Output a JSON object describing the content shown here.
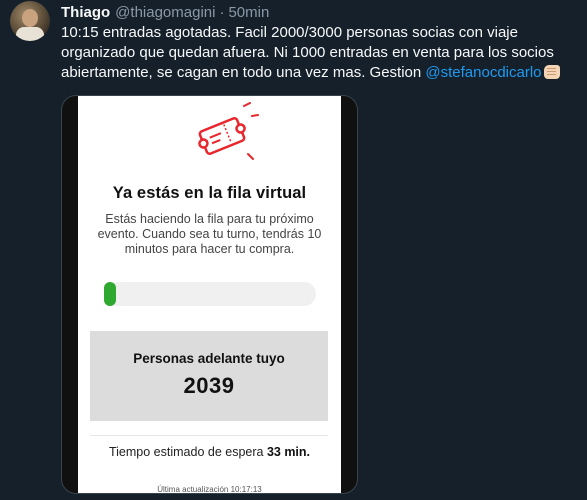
{
  "tweet": {
    "author_name": "Thiago",
    "handle": "@thiagomagini",
    "separator": "·",
    "time": "50min",
    "text_before": "10:15 entradas agotadas. Facil 2000/3000 personas socias con viaje organizado que quedan afuera. Ni 1000 entradas en venta para los socios abiertamente, se cagan en todo una vez mas. Gestion ",
    "mention": "@stefanocdicarlo",
    "emoji": "oncoming-fist-emoji"
  },
  "media": {
    "ticket_icon": "ticket-icon",
    "title": "Ya estás en la fila virtual",
    "body": "Estás haciendo la fila para tu próximo evento. Cuando sea tu turno, tendrás 10 minutos para hacer tu compra.",
    "progress_fraction": 0.05,
    "people_label": "Personas adelante tuyo",
    "people_count": "2039",
    "wait_prefix": "Tiempo estimado de espera ",
    "wait_value": "33 min.",
    "last_update": "Última actualización 10:17:13"
  },
  "colors": {
    "background": "#15202b",
    "accent": "#1d9bf0",
    "progress": "#2fa82f",
    "ticket": "#e8262c"
  }
}
